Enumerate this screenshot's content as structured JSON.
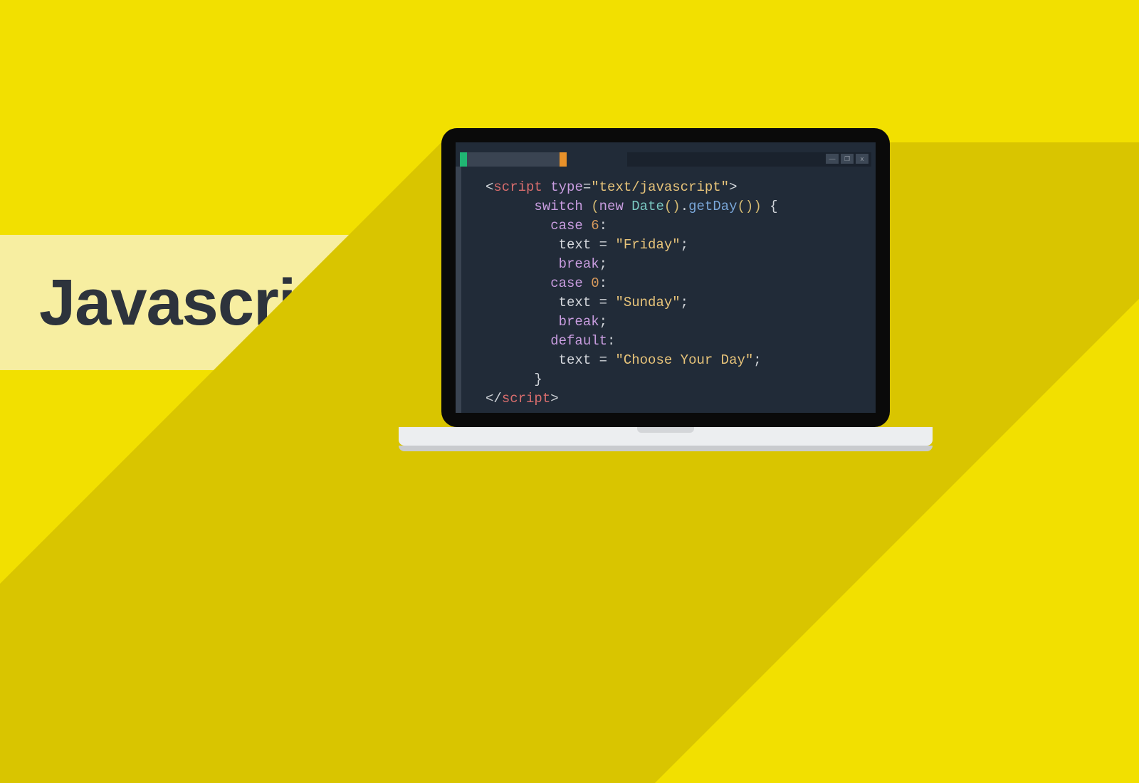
{
  "title": "Javascript",
  "window_controls": {
    "min": "—",
    "max": "❐",
    "close": "x"
  },
  "code": {
    "open_bracket": "<",
    "close_bracket": ">",
    "slash": "/",
    "tag": "script",
    "attr_name": "type",
    "attr_eq": "=",
    "attr_val": "\"text/javascript\"",
    "kw_switch": "switch",
    "kw_new": "new",
    "class_date": "Date",
    "empty_args": "()",
    "dot": ".",
    "method": "getDay",
    "call_args": "()",
    "close_paren": ")",
    "open_paren": "(",
    "brace_open": " {",
    "brace_close": "}",
    "kw_case": "case",
    "kw_default": "default",
    "colon": ":",
    "num6": "6",
    "num0": "0",
    "ident_text": "text",
    "eq": " = ",
    "str_friday": "\"Friday\"",
    "str_sunday": "\"Sunday\"",
    "str_choose": "\"Choose Your Day\"",
    "semi": ";",
    "kw_break": "break"
  }
}
